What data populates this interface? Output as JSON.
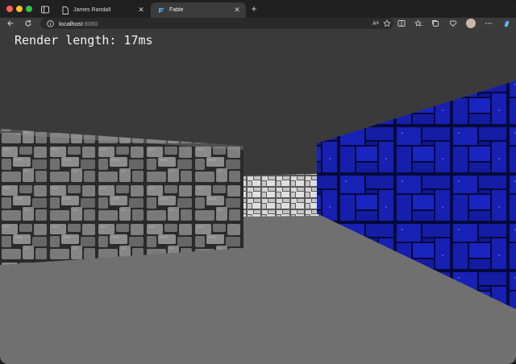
{
  "browser": {
    "tabs": [
      {
        "label": "James Randall",
        "active": false
      },
      {
        "label": "Fable",
        "active": true
      }
    ],
    "address": {
      "host": "localhost",
      "port": ":8080"
    }
  },
  "game": {
    "render_label": "Render length: 17ms",
    "colors": {
      "ceiling": "#3a3a3a",
      "floor": "#707070",
      "stone_wall": "#6b6b6b",
      "blue_wall": "#1a22c8"
    }
  }
}
